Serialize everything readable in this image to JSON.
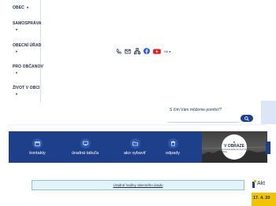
{
  "nav": {
    "items": [
      {
        "label": "OBEC"
      },
      {
        "label": "SAMOSPRÁVA"
      },
      {
        "label": "OBECNÍ ÚŘAD"
      },
      {
        "label": "PRO OBČANOV"
      },
      {
        "label": "ŽIVOT V OBCI"
      }
    ]
  },
  "social": {
    "icons": [
      "phone-icon",
      "mail-icon",
      "sitemap-icon",
      "facebook-icon",
      "youtube-icon"
    ],
    "language": "SK"
  },
  "search": {
    "label": "S čím Vám môžeme pomôcť?",
    "placeholder": ""
  },
  "quick_links": [
    {
      "label": "kontakty",
      "icon": "calendar-icon"
    },
    {
      "label": "úradná tabuľa",
      "icon": "board-icon"
    },
    {
      "label": "ako vybaviť",
      "icon": "folder-icon"
    },
    {
      "label": "odpady",
      "icon": "bin-icon"
    }
  ],
  "gallery_badge": {
    "title": "V OBRAZE",
    "subtitle": "FOTOGALÉRIE ZO ŽIVOTA OBCE"
  },
  "office_hours": {
    "label": "Úradné hodiny obecného úradu"
  },
  "news": {
    "heading_fragment": "Akt",
    "date_fragment": "17. 4. 20"
  },
  "colors": {
    "brand": "#1e3f8a",
    "accent": "#f2c400",
    "info_bg": "#e4f3f8"
  }
}
